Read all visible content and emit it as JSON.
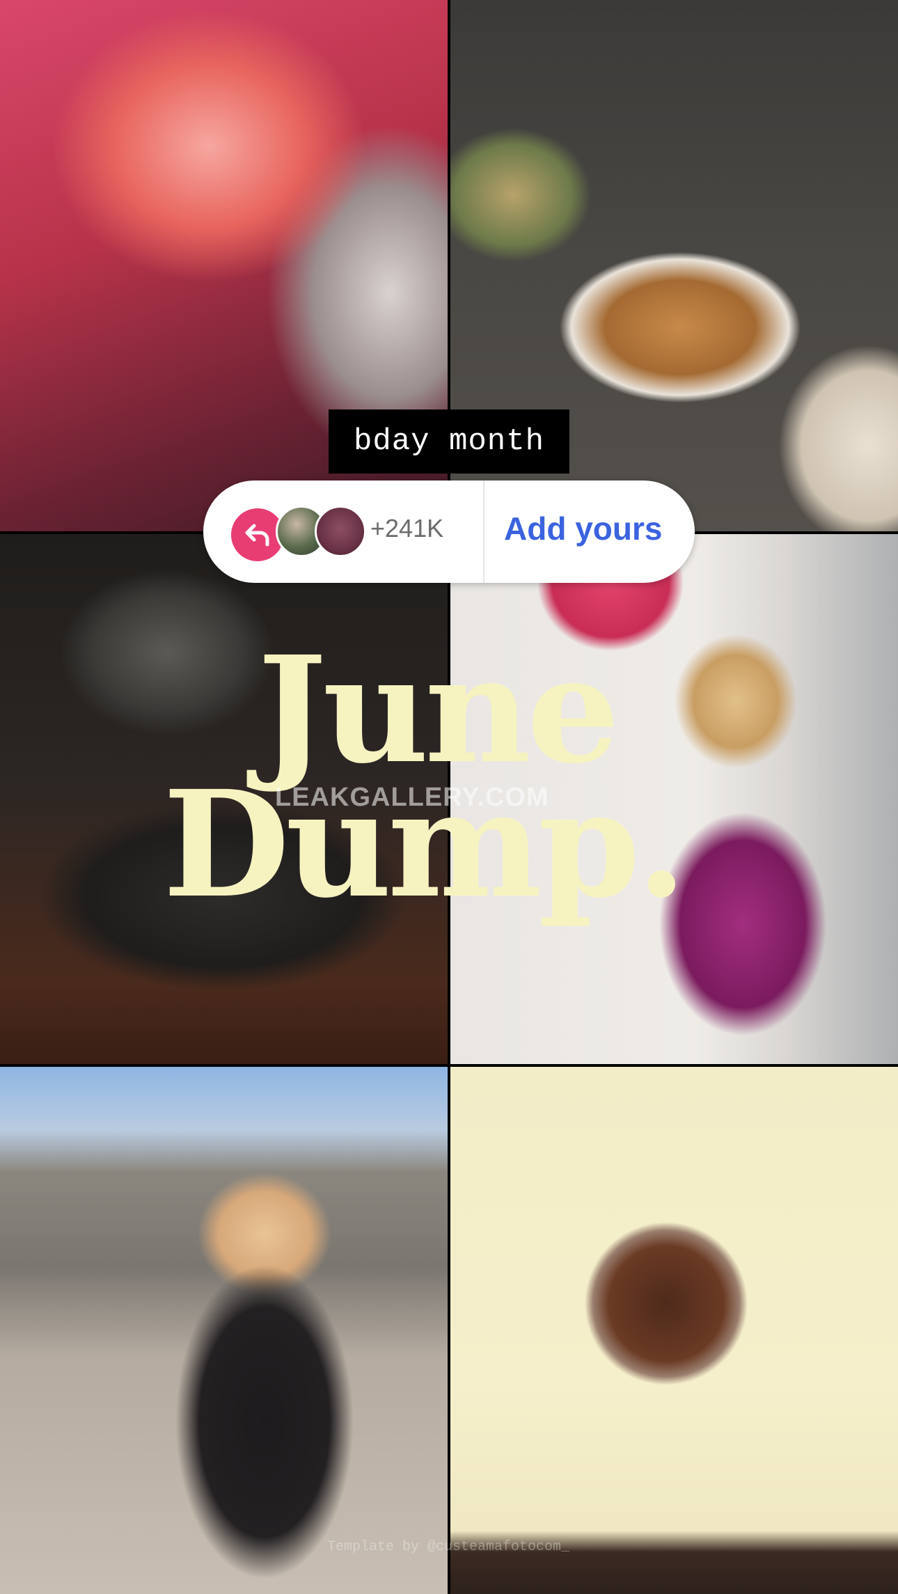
{
  "sticker": {
    "text": "bday month",
    "count": "+241K",
    "action": "Add yours",
    "accent_color": "#e83d73",
    "action_color": "#3b63e0",
    "icon": "reply-arrow-icon"
  },
  "overlay": {
    "line1": "June",
    "line2": "Dump.",
    "watermark": "LEAKGALLERY.COM",
    "credit": "Template by @custeamafotocom_"
  },
  "photos": [
    {
      "name": "selfie-red-light"
    },
    {
      "name": "roasted-cauliflower-bowl"
    },
    {
      "name": "tequila-shots-tray"
    },
    {
      "name": "birthday-balloon-dress"
    },
    {
      "name": "milan-duomo-selfie"
    },
    {
      "name": "jar-dessert"
    }
  ]
}
